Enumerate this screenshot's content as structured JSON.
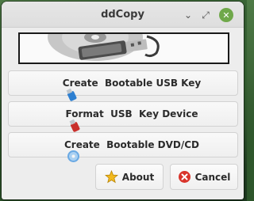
{
  "window": {
    "title": "ddCopy",
    "minimize_glyph": "⌄",
    "maximize_glyph": "⤢",
    "close_glyph": "✕"
  },
  "banner": {
    "image": "usb-key-and-disc-banner"
  },
  "actions": {
    "create_usb": {
      "label": "Create  Bootable USB Key",
      "icon": "usb-drive-blue-icon"
    },
    "format_usb": {
      "label": "Format  USB  Key Device",
      "icon": "usb-drive-red-icon"
    },
    "create_dvd": {
      "label": "Create  Bootable DVD/CD",
      "icon": "disc-icon"
    }
  },
  "footer": {
    "about_label": "About",
    "about_icon": "star-icon",
    "cancel_label": "Cancel",
    "cancel_icon": "cancel-circle-icon"
  },
  "colors": {
    "window_bg": "#ededed",
    "close_button": "#6fa84a",
    "cancel_icon": "#d9342b",
    "star_icon": "#f2b91e",
    "desktop": "#3a6b36"
  }
}
